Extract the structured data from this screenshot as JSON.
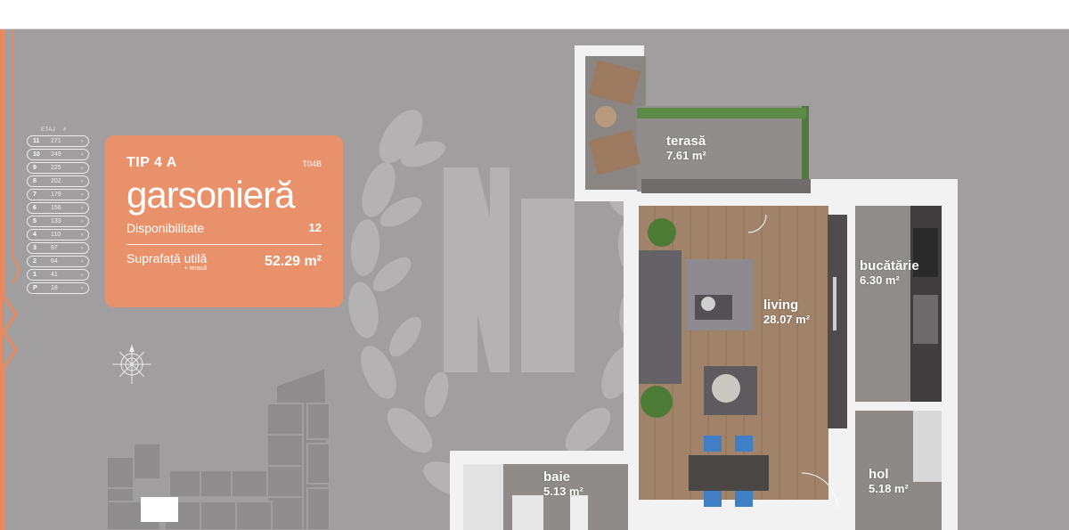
{
  "card": {
    "tip": "TIP 4 A",
    "code": "T04B",
    "type": "garsonieră",
    "availability_label": "Disponibilitate",
    "availability_value": "12",
    "area_label": "Suprafață utilă",
    "area_sublabel": "+ terasă",
    "area_value": "52.29 m²"
  },
  "floors": {
    "header_level": "ETAJ",
    "header_count": "#",
    "items": [
      {
        "level": "11",
        "count": "271"
      },
      {
        "level": "10",
        "count": "249"
      },
      {
        "level": "9",
        "count": "225"
      },
      {
        "level": "8",
        "count": "202"
      },
      {
        "level": "7",
        "count": "179"
      },
      {
        "level": "6",
        "count": "156"
      },
      {
        "level": "5",
        "count": "133"
      },
      {
        "level": "4",
        "count": "110"
      },
      {
        "level": "3",
        "count": "87"
      },
      {
        "level": "2",
        "count": "64"
      },
      {
        "level": "1",
        "count": "41"
      },
      {
        "level": "P",
        "count": "18"
      }
    ]
  },
  "rooms": {
    "terasa": {
      "name": "terasă",
      "area": "7.61 m²"
    },
    "bucatarie": {
      "name": "bucătărie",
      "area": "6.30 m²"
    },
    "living": {
      "name": "living",
      "area": "28.07 m²"
    },
    "baie": {
      "name": "baie",
      "area": "5.13 m²"
    },
    "hol": {
      "name": "hol",
      "area": "5.18 m²"
    }
  },
  "colors": {
    "background": "#a19e9f",
    "accent": "#e9916a",
    "edge": "#e88a5e"
  }
}
